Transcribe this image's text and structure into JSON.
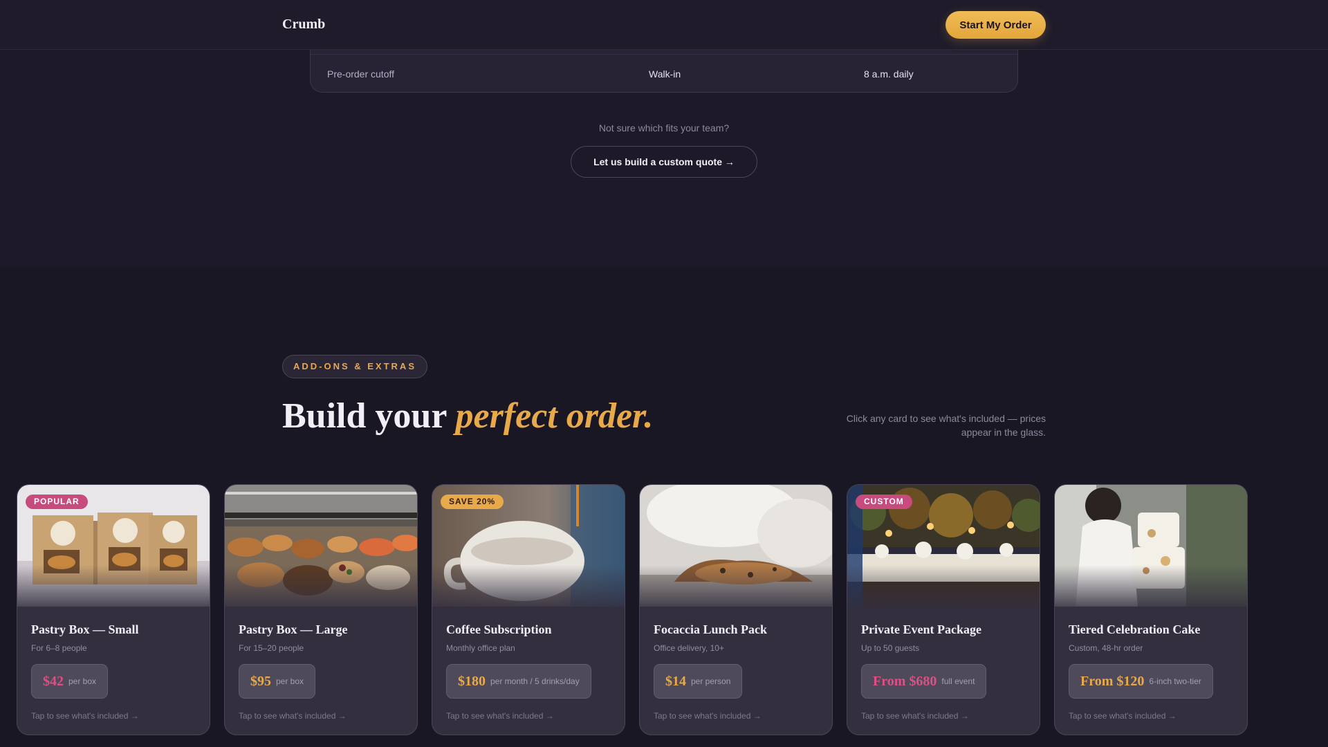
{
  "header": {
    "brand": "Crumb",
    "cta_label": "Start My Order"
  },
  "schedule_row": {
    "label": "Pre-order cutoff",
    "walkin": "Walk-in",
    "time": "8 a.m. daily"
  },
  "help": {
    "text": "Not sure which fits your team?",
    "quote_button": "Let us build a custom quote →"
  },
  "section": {
    "tag": "ADD-ONS & EXTRAS",
    "heading_plain": "Build your ",
    "heading_emphasis": "perfect order.",
    "note": "Click any card to see what's included — prices appear in the glass."
  },
  "cards": [
    {
      "badge": "POPULAR",
      "title": "Pastry Box — Small",
      "subtitle": "For 6–8 people",
      "price": "$42",
      "unit": "per box",
      "tap": "Tap to see what's included →"
    },
    {
      "badge": "",
      "title": "Pastry Box — Large",
      "subtitle": "For 15–20 people",
      "price": "$95",
      "unit": "per box",
      "tap": "Tap to see what's included →"
    },
    {
      "badge": "SAVE 20%",
      "title": "Coffee Subscription",
      "subtitle": "Monthly office plan",
      "price": "$180",
      "unit": "per month / 5 drinks/day",
      "tap": "Tap to see what's included →"
    },
    {
      "badge": "",
      "title": "Focaccia Lunch Pack",
      "subtitle": "Office delivery, 10+",
      "price": "$14",
      "unit": "per person",
      "tap": "Tap to see what's included →"
    },
    {
      "badge": "CUSTOM",
      "title": "Private Event Package",
      "subtitle": "Up to 50 guests",
      "price": "From $680",
      "unit": "full event",
      "tap": "Tap to see what's included →"
    },
    {
      "badge": "",
      "title": "Tiered Celebration Cake",
      "subtitle": "Custom, 48-hr order",
      "price": "From $120",
      "unit": "6-inch two-tier",
      "tap": "Tap to see what's included →"
    }
  ],
  "colors": {
    "accent_gold": "#e8a94b",
    "accent_pink": "#c74c7d",
    "background": "#1d1928"
  }
}
